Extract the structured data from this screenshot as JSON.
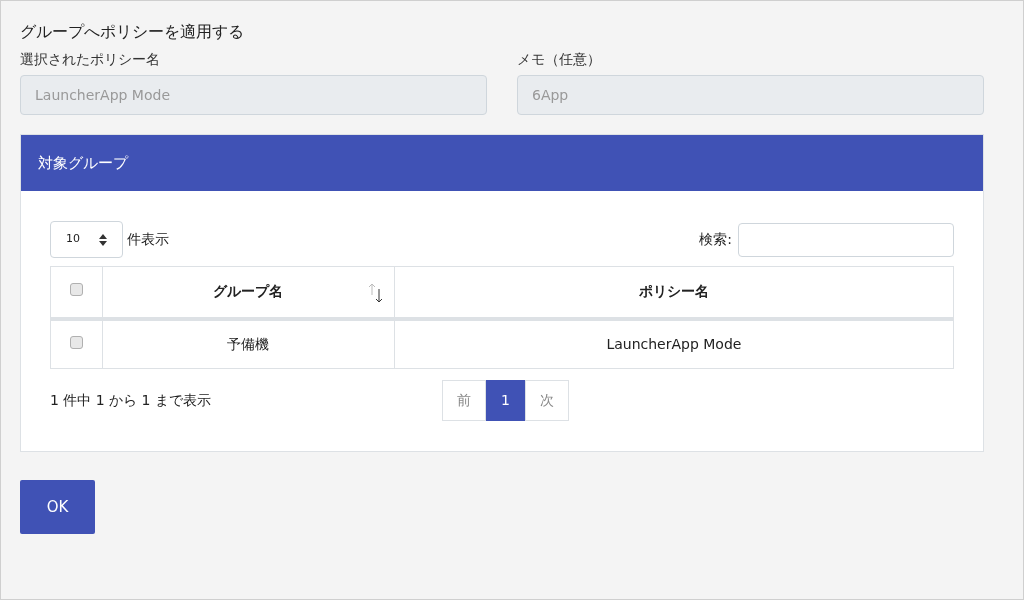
{
  "title": "グループへポリシーを適用する",
  "fields": [
    {
      "label": "選択されたポリシー名",
      "value": "LauncherApp Mode",
      "disabled": true
    },
    {
      "label": "メモ（任意）",
      "value": "6App",
      "disabled": true
    }
  ],
  "panel": {
    "title": "対象グループ",
    "page_length": {
      "value": "10",
      "label": "件表示"
    },
    "search": {
      "label": "検索:"
    },
    "table": {
      "header_checked": false,
      "columns": [
        "グループ名",
        "ポリシー名"
      ],
      "rows": [
        {
          "checked": false,
          "cells": [
            "予備機",
            "LauncherApp Mode"
          ]
        }
      ]
    },
    "info": "1 件中 1 から 1 まで表示",
    "pagination": [
      {
        "label": "前",
        "selected": false,
        "disabled": true
      },
      {
        "label": "1",
        "selected": true,
        "disabled": false
      },
      {
        "label": "次",
        "selected": false,
        "disabled": true
      }
    ]
  },
  "buttons": [
    {
      "label": "OK"
    }
  ]
}
